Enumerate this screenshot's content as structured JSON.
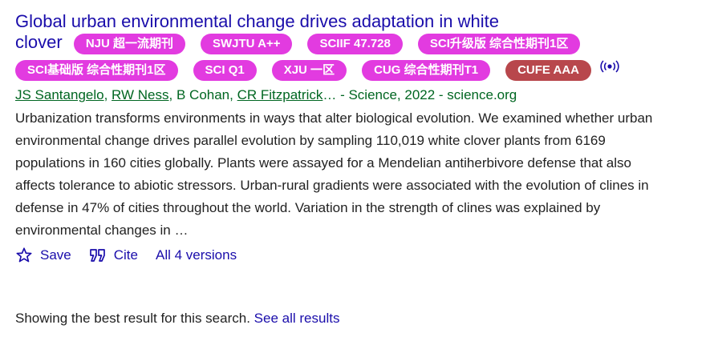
{
  "result": {
    "title_line1": "Global urban environmental change drives adaptation in white",
    "title_line2": "clover",
    "badges_row1": [
      "NJU 超一流期刊",
      "SWJTU A++",
      "SCIIF 47.728",
      "SCI升级版 综合性期刊1区"
    ],
    "badges_row2": [
      "SCI基础版 综合性期刊1区",
      "SCI Q1",
      "XJU 一区",
      "CUG 综合性期刊T1",
      "CUFE AAA"
    ],
    "authors": [
      "JS Santangelo",
      "RW Ness"
    ],
    "author_plain": "B Cohan",
    "author_last": "CR Fitzpatrick",
    "ellipsis": "…",
    "source": " - Science, 2022 - science.org",
    "snippet": "Urbanization transforms environments in ways that alter biological evolution. We examined whether urban environmental change drives parallel evolution by sampling 110,019 white clover plants from 6169 populations in 160 cities globally. Plants were assayed for a Mendelian antiherbivore defense that also affects tolerance to abiotic stressors. Urban-rural gradients were associated with the evolution of clines in defense in 47% of cities throughout the world. Variation in the strength of clines was explained by environmental changes in …",
    "actions": {
      "save_label": "Save",
      "cite_label": "Cite",
      "versions_label": "All 4 versions"
    }
  },
  "footer": {
    "message": "Showing the best result for this search.",
    "see_all_label": "See all results"
  },
  "colors": {
    "link": "#1a0dab",
    "author_green": "#006621",
    "badge_pink": "#e23be0",
    "badge_dark": "#b8474c"
  },
  "icons": [
    "star-icon",
    "quote-icon",
    "radio-signal-icon"
  ]
}
